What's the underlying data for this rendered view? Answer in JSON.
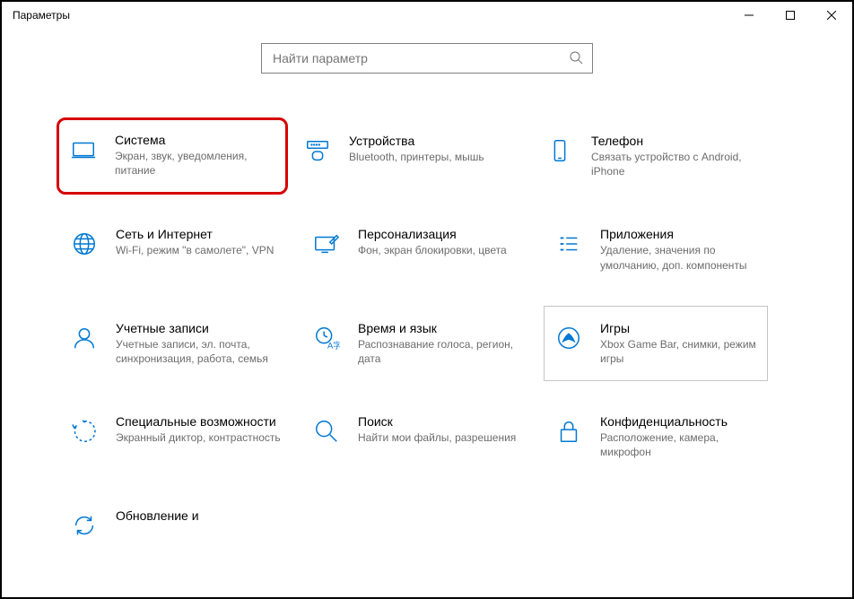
{
  "window": {
    "title": "Параметры"
  },
  "search": {
    "placeholder": "Найти параметр"
  },
  "categories": {
    "system": {
      "title": "Система",
      "desc": "Экран, звук, уведомления, питание"
    },
    "devices": {
      "title": "Устройства",
      "desc": "Bluetooth, принтеры, мышь"
    },
    "phone": {
      "title": "Телефон",
      "desc": "Связать устройство с Android, iPhone"
    },
    "network": {
      "title": "Сеть и Интернет",
      "desc": "Wi-Fi, режим \"в самолете\", VPN"
    },
    "personal": {
      "title": "Персонализация",
      "desc": "Фон, экран блокировки, цвета"
    },
    "apps": {
      "title": "Приложения",
      "desc": "Удаление, значения по умолчанию, доп. компоненты"
    },
    "accounts": {
      "title": "Учетные записи",
      "desc": "Учетные записи, эл. почта, синхронизация, работа, семья"
    },
    "time": {
      "title": "Время и язык",
      "desc": "Распознавание голоса, регион, дата"
    },
    "games": {
      "title": "Игры",
      "desc": "Xbox Game Bar, снимки, режим игры"
    },
    "access": {
      "title": "Специальные возможности",
      "desc": "Экранный диктор, контрастность"
    },
    "searchc": {
      "title": "Поиск",
      "desc": "Найти мои файлы, разрешения"
    },
    "privacy": {
      "title": "Конфиденциальность",
      "desc": "Расположение, камера, микрофон"
    },
    "update": {
      "title": "Обновление и",
      "desc": ""
    }
  }
}
